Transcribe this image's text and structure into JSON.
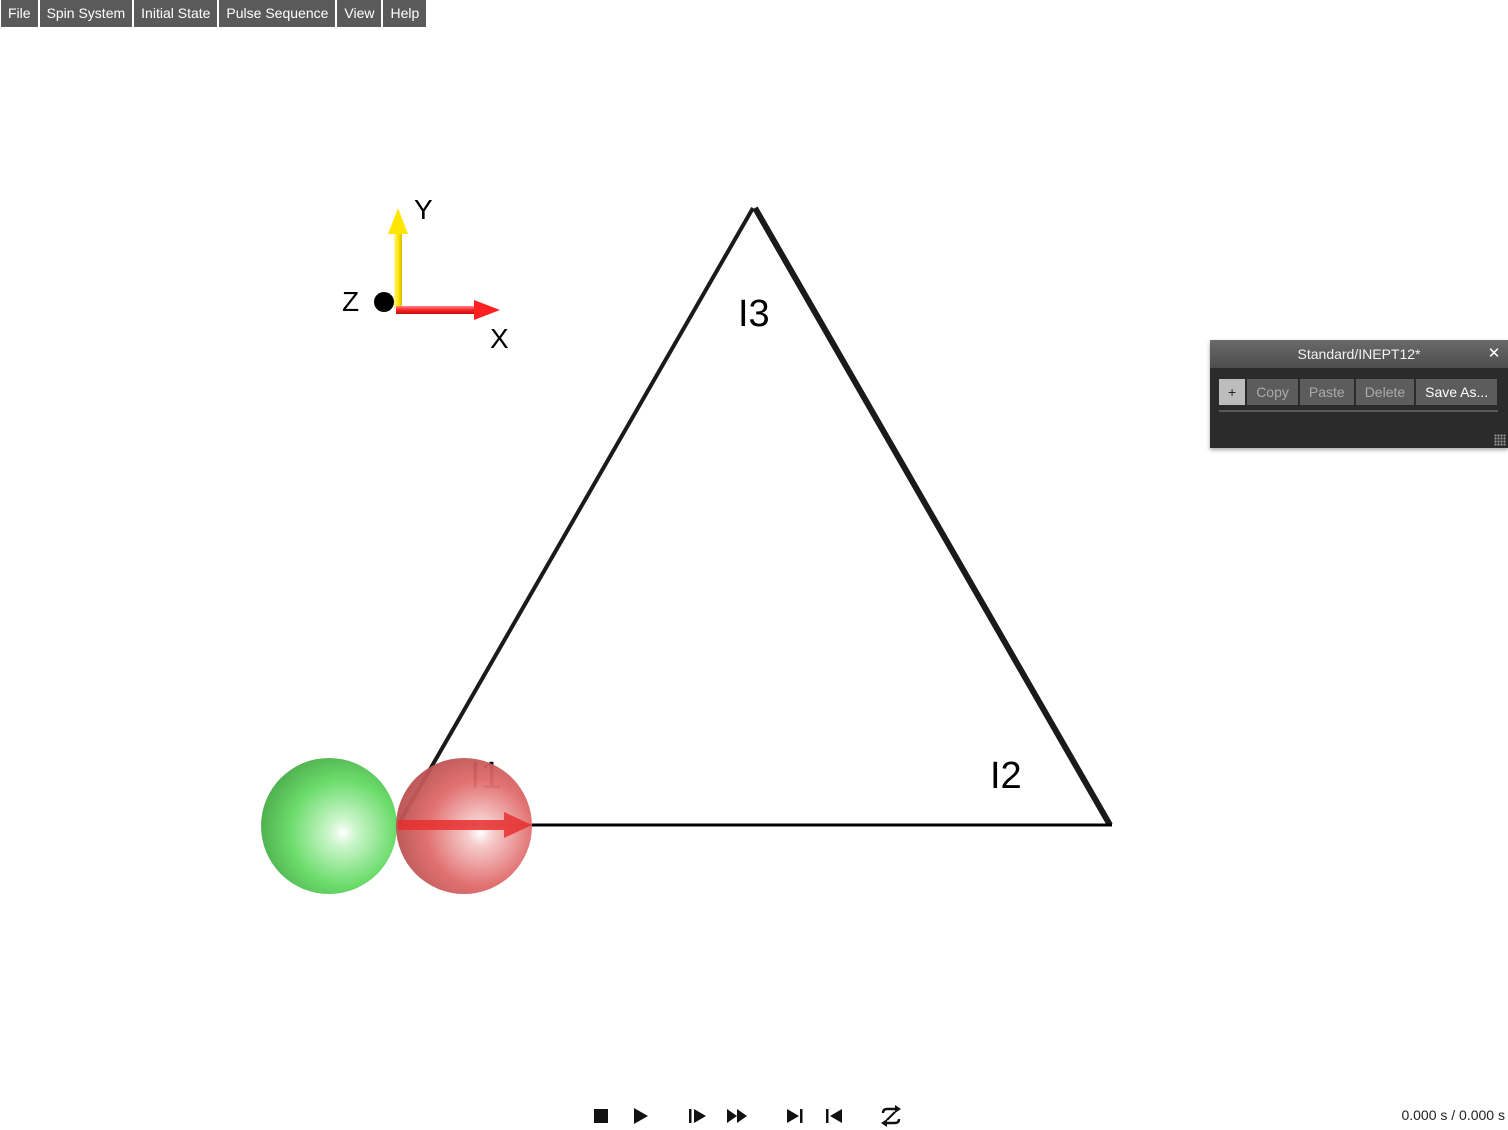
{
  "menubar": {
    "items": [
      "File",
      "Spin System",
      "Initial State",
      "Pulse Sequence",
      "View",
      "Help"
    ]
  },
  "axes": {
    "x_label": "X",
    "y_label": "Y",
    "z_label": "Z"
  },
  "spins": {
    "labels": [
      "I1",
      "I2",
      "I3"
    ]
  },
  "sequence_panel": {
    "title": "Standard/INEPT12*",
    "close_glyph": "✕",
    "buttons": {
      "add": "+",
      "copy": "Copy",
      "paste": "Paste",
      "delete": "Delete",
      "save_as": "Save As..."
    }
  },
  "playback": {
    "time": "0.000 s / 0.000 s"
  },
  "colors": {
    "menu_bg": "#5a5a5a",
    "x_axis": "#ff2b2b",
    "y_axis": "#ffe600",
    "sphere_green": "#5fd65f",
    "sphere_red": "#e46a6a"
  }
}
